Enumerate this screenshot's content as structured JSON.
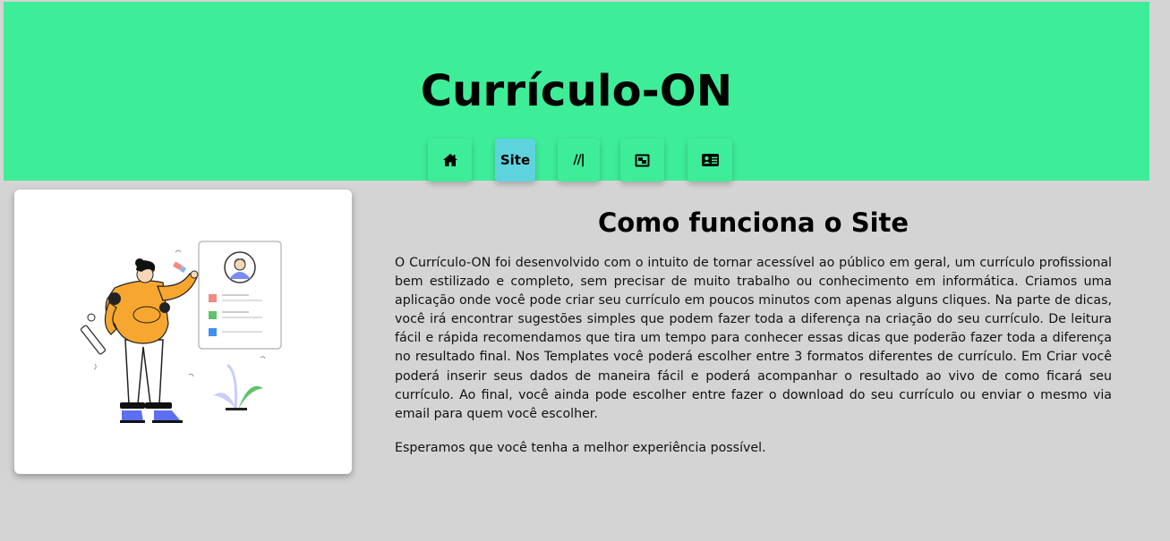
{
  "header": {
    "title": "Currículo-ON",
    "background": "#3eed98",
    "nav": [
      {
        "icon": "home-icon",
        "label": "",
        "active": false
      },
      {
        "icon": "",
        "label": "Site",
        "active": true
      },
      {
        "icon": "",
        "label": "//|",
        "active": false
      },
      {
        "icon": "template-icon",
        "label": "",
        "active": false
      },
      {
        "icon": "id-card-icon",
        "label": "",
        "active": false
      }
    ],
    "active_color": "#5fd3dd"
  },
  "illustration": {
    "icon": "resume-illustration"
  },
  "main": {
    "heading": "Como funciona o Site",
    "paragraph1": "O Currículo-ON foi desenvolvido com o intuito de tornar acessível ao público em geral, um currículo profissional bem estilizado e completo, sem precisar de muito trabalho ou conhecimento em informática. Criamos uma aplicação onde você pode criar seu currículo em poucos minutos com apenas alguns cliques. Na parte de dicas, você irá encontrar sugestões simples que podem fazer toda a diferença na criação do seu currículo. De leitura fácil e rápida recomendamos que tira um tempo para conhecer essas dicas que poderão fazer toda a diferença no resultado final. Nos Templates você poderá escolher entre 3 formatos diferentes de currículo. Em Criar você poderá inserir seus dados de maneira fácil e poderá acompanhar o resultado ao vivo de como ficará seu currículo. Ao final, você ainda pode escolher entre fazer o download do seu currículo ou enviar o mesmo via email para quem você escolher.",
    "paragraph2": "Esperamos que você tenha a melhor experiência possível."
  }
}
